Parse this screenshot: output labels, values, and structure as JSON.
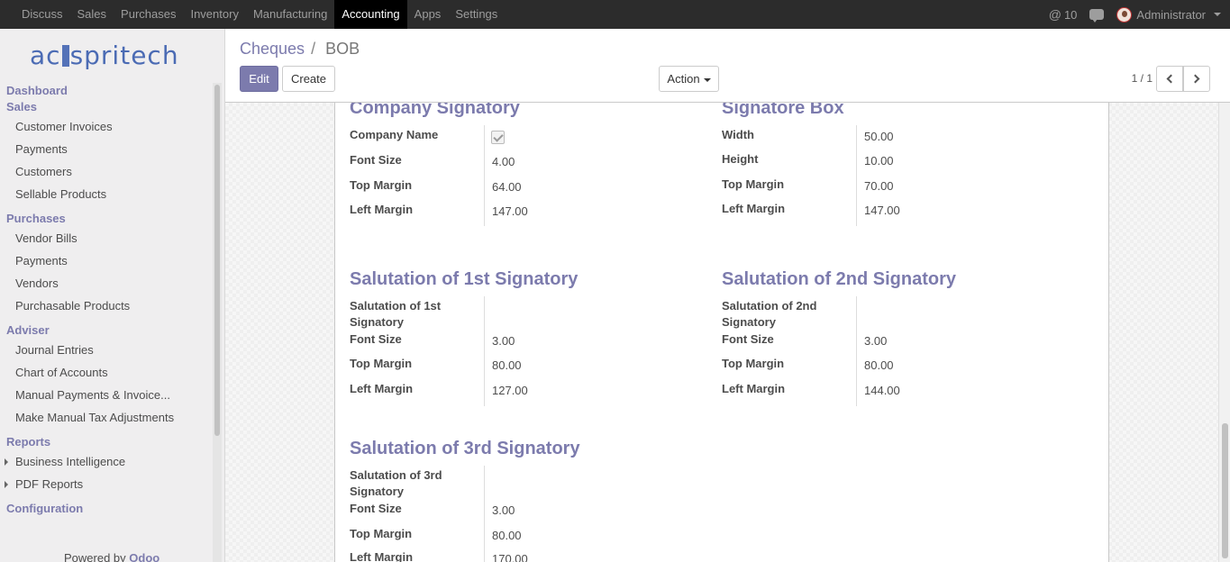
{
  "topbar": {
    "menu": [
      "Discuss",
      "Sales",
      "Purchases",
      "Inventory",
      "Manufacturing",
      "Accounting",
      "Apps",
      "Settings"
    ],
    "active": "Accounting",
    "mentions": "10",
    "user": "Administrator"
  },
  "sidebar": {
    "logo": "acspritech",
    "dashboard": "Dashboard",
    "sales": "Sales",
    "sales_items": [
      "Customer Invoices",
      "Payments",
      "Customers",
      "Sellable Products"
    ],
    "purchases": "Purchases",
    "purchases_items": [
      "Vendor Bills",
      "Payments",
      "Vendors",
      "Purchasable Products"
    ],
    "adviser": "Adviser",
    "adviser_items": [
      "Journal Entries",
      "Chart of Accounts",
      "Manual Payments & Invoice...",
      "Make Manual Tax Adjustments"
    ],
    "reports": "Reports",
    "reports_items": [
      "Business Intelligence",
      "PDF Reports"
    ],
    "configuration": "Configuration",
    "powered_prefix": "Powered by",
    "powered_brand": "Odoo"
  },
  "control": {
    "breadcrumb_parent": "Cheques",
    "breadcrumb_sep": "/",
    "breadcrumb_current": "BOB",
    "edit": "Edit",
    "create": "Create",
    "action": "Action",
    "pager": "1 / 1"
  },
  "form": {
    "company_signatory": {
      "title": "Company Signatory",
      "company_name_label": "Company Name",
      "company_name_checked": true,
      "font_size_label": "Font Size",
      "font_size": "4.00",
      "top_margin_label": "Top Margin",
      "top_margin": "64.00",
      "left_margin_label": "Left Margin",
      "left_margin": "147.00"
    },
    "signatore_box": {
      "title": "Signatore Box",
      "width_label": "Width",
      "width": "50.00",
      "height_label": "Height",
      "height": "10.00",
      "top_margin_label": "Top Margin",
      "top_margin": "70.00",
      "left_margin_label": "Left Margin",
      "left_margin": "147.00"
    },
    "sal1": {
      "title": "Salutation of 1st Signatory",
      "sal_label": "Salutation of 1st Signatory",
      "font_size_label": "Font Size",
      "font_size": "3.00",
      "top_margin_label": "Top Margin",
      "top_margin": "80.00",
      "left_margin_label": "Left Margin",
      "left_margin": "127.00"
    },
    "sal2": {
      "title": "Salutation of 2nd Signatory",
      "sal_label": "Salutation of 2nd Signatory",
      "font_size_label": "Font Size",
      "font_size": "3.00",
      "top_margin_label": "Top Margin",
      "top_margin": "80.00",
      "left_margin_label": "Left Margin",
      "left_margin": "144.00"
    },
    "sal3": {
      "title": "Salutation of 3rd Signatory",
      "sal_label": "Salutation of 3rd Signatory",
      "font_size_label": "Font Size",
      "font_size": "3.00",
      "top_margin_label": "Top Margin",
      "top_margin": "80.00",
      "left_margin_label": "Left Margin",
      "left_margin": "170.00"
    }
  }
}
